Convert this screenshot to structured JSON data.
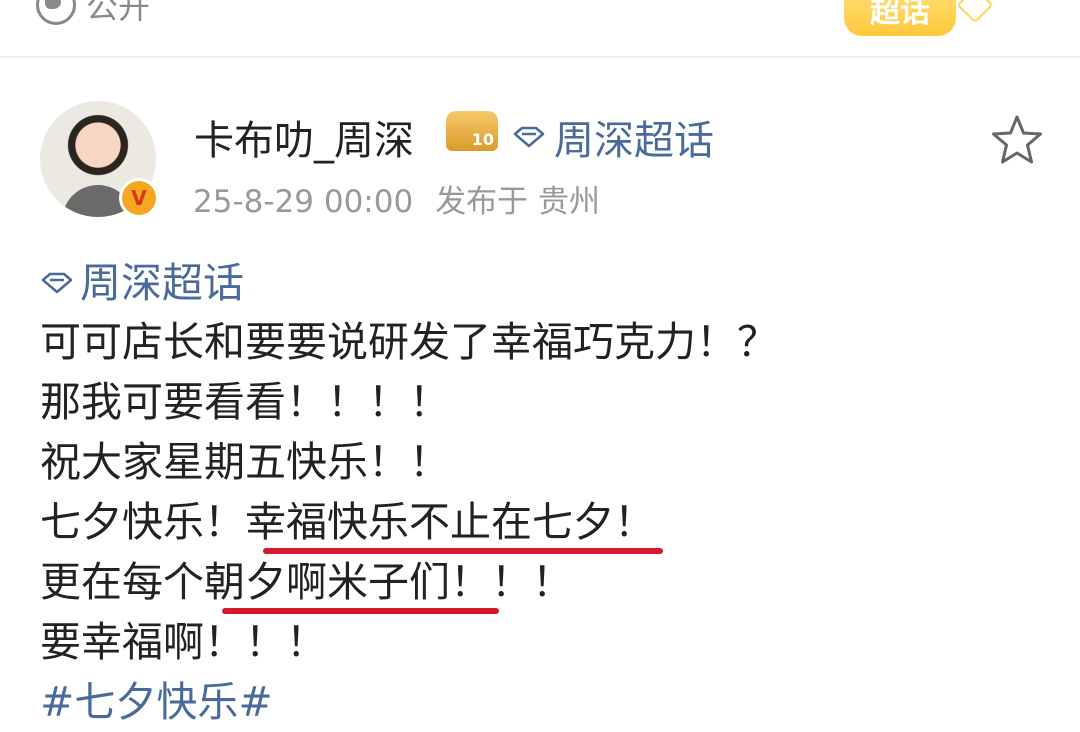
{
  "top": {
    "visibility_label": "公开",
    "chaohua_badge": "超话"
  },
  "post": {
    "author": "卡布叻_周深",
    "fan_badge_level": "10",
    "topic_header": "周深超话",
    "time": "25-8-29 00:00",
    "location": "发布于 贵州"
  },
  "body": {
    "topic_link": "周深超话",
    "lines": [
      "可可店长和要要说研发了幸福巧克力！？",
      "那我可要看看！！！！",
      "祝大家星期五快乐！！",
      "七夕快乐！",
      "幸福快乐不止在七夕！",
      "更在每个",
      "朝夕啊米子们！",
      "！！",
      "要幸福啊！！！"
    ],
    "hashtag": "#七夕快乐#"
  },
  "icons": {
    "visibility": "globe-icon",
    "verified": "verified-badge-icon",
    "fan": "crown-badge-icon",
    "topic": "diamond-icon",
    "favorite": "star-outline-icon"
  },
  "colors": {
    "link": "#4a6b9a",
    "underline": "#d8182c",
    "meta": "#999999",
    "badge": "#ffc93d"
  }
}
